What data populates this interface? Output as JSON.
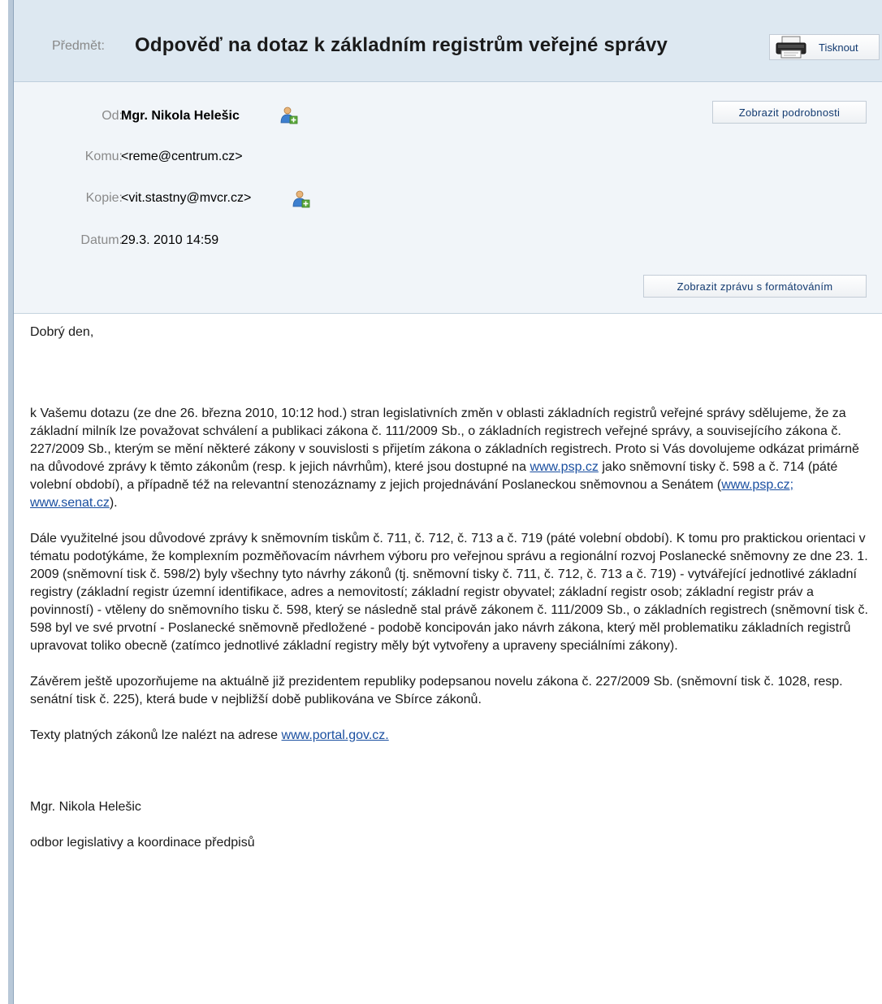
{
  "subject": {
    "label": "Předmět:",
    "text": "Odpověď na dotaz k základním registrům veřejné správy",
    "print_label": "Tisknout"
  },
  "header": {
    "from_label": "Od:",
    "from_value": "Mgr. Nikola Helešic",
    "to_label": "Komu:",
    "to_value": "<reme@centrum.cz>",
    "cc_label": "Kopie:",
    "cc_value": "<vit.stastny@mvcr.cz>",
    "date_label": "Datum:",
    "date_value": "29.3. 2010 14:59",
    "details_button": "Zobrazit podrobnosti",
    "formatting_button": "Zobrazit zprávu s formátováním"
  },
  "body": {
    "greeting": "Dobrý den,",
    "p1_a": "k Vašemu dotazu (ze dne 26. března 2010, 10:12 hod.) stran legislativních změn v oblasti základních registrů veřejné správy sdělujeme, že za základní milník lze považovat schválení a publikaci zákona č. 111/2009 Sb., o základních registrech veřejné správy, a souvisejícího zákona č. 227/2009 Sb., kterým se mění některé zákony v souvislosti s přijetím zákona o základních registrech. Proto si Vás dovolujeme odkázat primárně na důvodové zprávy k těmto zákonům (resp. k jejich návrhům), které jsou dostupné na",
    "p1_link1": "www.psp.cz",
    "p1_b": "jako sněmovní tisky č. 598 a č. 714 (páté volební období), a případně též na relevantní stenozáznamy z jejich projednávání Poslaneckou sněmovnou a Senátem (",
    "p1_link2": "www.psp.cz;",
    "p1_link3": "www.senat.cz",
    "p1_c": ").",
    "p2": "Dále využitelné jsou důvodové zprávy k sněmovním tiskům č. 711, č. 712, č. 713 a č. 719 (páté volební období). K tomu pro praktickou orientaci v tématu podotýkáme, že komplexním pozměňovacím návrhem výboru pro veřejnou správu a regionální rozvoj Poslanecké sněmovny ze dne 23. 1. 2009 (sněmovní tisk č. 598/2) byly všechny tyto návrhy zákonů (tj. sněmovní tisky č. 711, č. 712, č. 713 a č. 719) - vytvářející jednotlivé základní registry (základní registr územní identifikace, adres a nemovitostí; základní registr obyvatel; základní registr osob; základní registr práv a povinností) - vtěleny do sněmovního tisku č. 598, který se následně stal právě zákonem č. 111/2009 Sb., o základních registrech (sněmovní tisk č. 598 byl ve své prvotní - Poslanecké sněmovně předložené - podobě koncipován jako návrh zákona, který měl problematiku základních registrů upravovat toliko obecně (zatímco jednotlivé základní registry měly být vytvořeny a upraveny speciálními zákony).",
    "p3": "Závěrem ještě upozorňujeme na aktuálně již prezidentem republiky podepsanou novelu zákona č. 227/2009 Sb. (sněmovní tisk č. 1028, resp. senátní tisk č. 225), která bude v nejbližší době publikována ve Sbírce zákonů.",
    "p4_a": "Texty platných zákonů lze nalézt na adrese",
    "p4_link": "www.portal.gov.cz.",
    "sig_name": "Mgr. Nikola Helešic",
    "sig_dept": "odbor legislativy a koordinace předpisů"
  },
  "icons": {
    "printer": "printer-icon",
    "add_contact": "add-contact-icon"
  }
}
